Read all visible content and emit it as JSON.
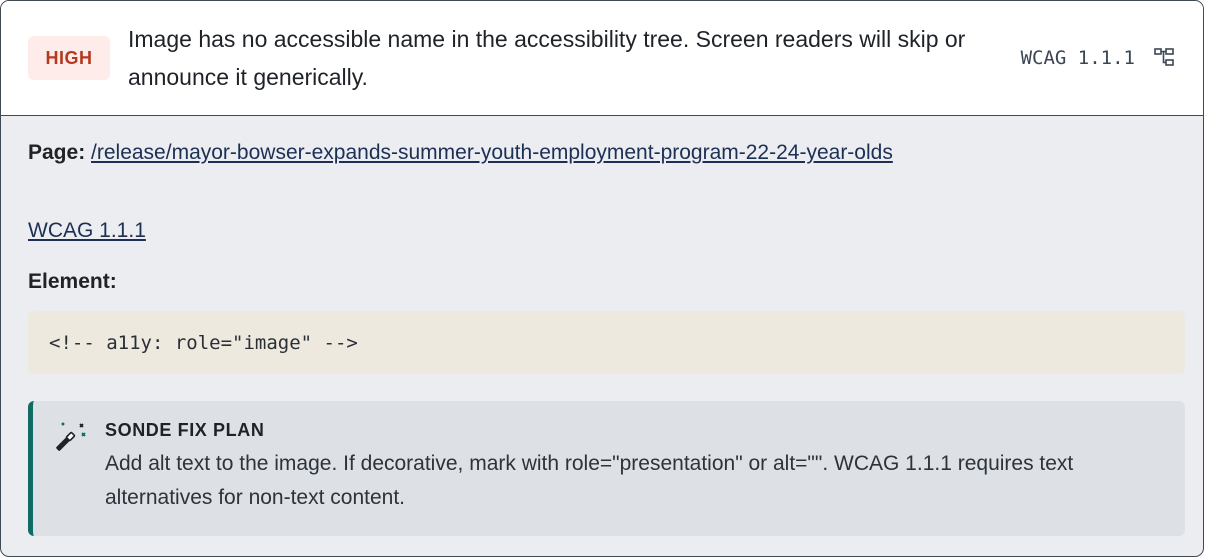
{
  "summary": {
    "severity": "HIGH",
    "message": "Image has no accessible name in the accessibility tree. Screen readers will skip or announce it generically.",
    "wcag_code": "WCAG 1.1.1",
    "tree_icon": "tree-structure-icon"
  },
  "details": {
    "page_label": "Page:",
    "page_link": "/release/mayor-bowser-expands-summer-youth-employment-program-22-24-year-olds",
    "wcag_link": "WCAG 1.1.1",
    "element_label": "Element:",
    "element_code": "<!-- a11y: role=\"image\" -->"
  },
  "fix": {
    "icon": "magic-wand-icon",
    "title": "SONDE FIX PLAN",
    "text": "Add alt text to the image. If decorative, mark with role=\"presentation\" or alt=\"\". WCAG 1.1.1 requires text alternatives for non-text content."
  },
  "colors": {
    "severity_text": "#b5381f",
    "severity_bg": "#fdecea",
    "accent_border": "#0f6b63",
    "link": "#1d2f55"
  }
}
